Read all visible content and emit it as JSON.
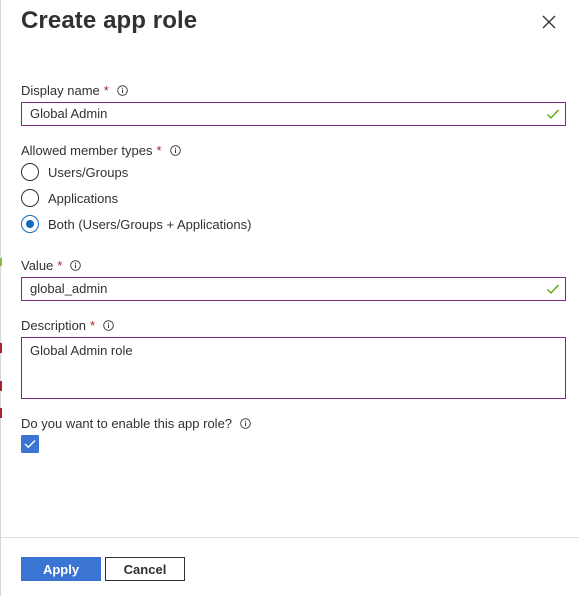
{
  "panel": {
    "title": "Create app role"
  },
  "display_name": {
    "label": "Display name",
    "required_mark": "*",
    "value": "Global Admin"
  },
  "member_types": {
    "label": "Allowed member types",
    "required_mark": "*",
    "options": [
      {
        "label": "Users/Groups",
        "selected": false
      },
      {
        "label": "Applications",
        "selected": false
      },
      {
        "label": "Both (Users/Groups + Applications)",
        "selected": true
      }
    ]
  },
  "value_field": {
    "label": "Value",
    "required_mark": "*",
    "value": "global_admin"
  },
  "description": {
    "label": "Description",
    "required_mark": "*",
    "value": "Global Admin role"
  },
  "enable": {
    "label": "Do you want to enable this app role?",
    "checked": true
  },
  "footer": {
    "apply_label": "Apply",
    "cancel_label": "Cancel"
  },
  "colors": {
    "primary": "#3a75d4",
    "input_border": "#7a2c7f",
    "required": "#a4262c",
    "valid_check": "#57a300",
    "radio_selected": "#0f6cbd"
  },
  "icons": {
    "close": "close-icon",
    "info": "info-icon",
    "valid": "checkmark-icon"
  }
}
